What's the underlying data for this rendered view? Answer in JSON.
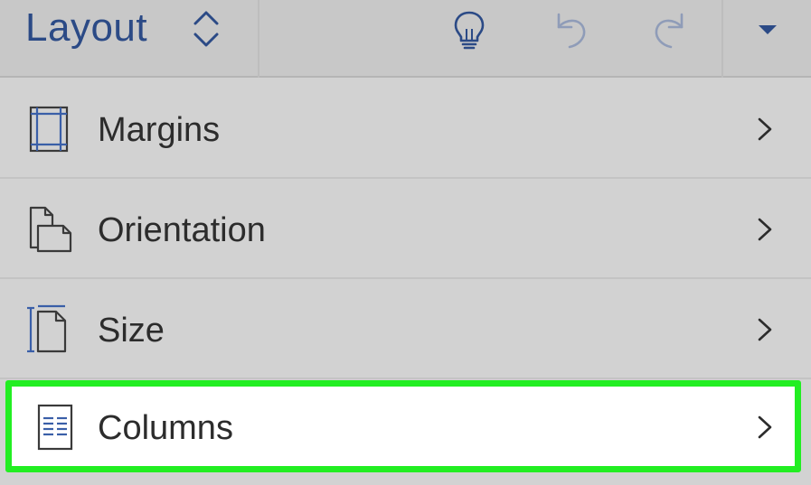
{
  "toolbar": {
    "tab_title": "Layout",
    "icons": {
      "switch": "up-down-chevron-icon",
      "tell_me": "lightbulb-icon",
      "undo": "undo-icon",
      "redo": "redo-icon",
      "more": "dropdown-triangle-icon"
    }
  },
  "menu": {
    "items": [
      {
        "label": "Margins",
        "icon": "margins-icon"
      },
      {
        "label": "Orientation",
        "icon": "orientation-icon"
      },
      {
        "label": "Size",
        "icon": "page-size-icon"
      },
      {
        "label": "Columns",
        "icon": "columns-icon",
        "highlighted": true
      }
    ]
  },
  "colors": {
    "accent_blue": "#2b4a86",
    "icon_blue": "#3a5fa8",
    "highlight_border": "#22ee22",
    "background": "#d2d2d2"
  }
}
